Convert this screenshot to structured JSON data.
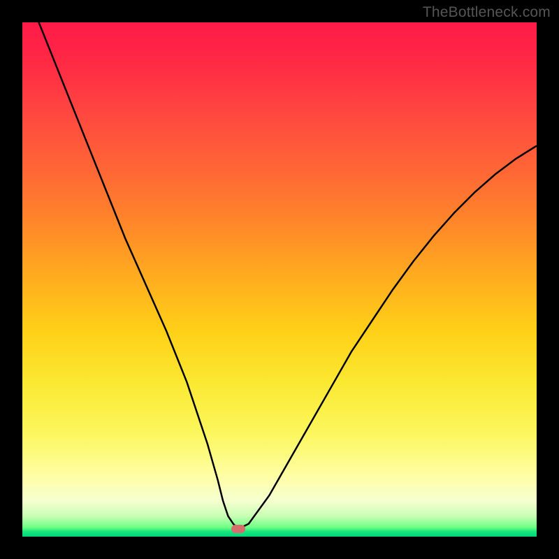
{
  "watermark": "TheBottleneck.com",
  "colors": {
    "frame": "#000000",
    "marker": "#d86d6d",
    "curve": "#000000",
    "gradient_top": "#ff1a48",
    "gradient_bottom": "#00d47a"
  },
  "chart_data": {
    "type": "line",
    "title": "",
    "xlabel": "",
    "ylabel": "",
    "xlim": [
      0,
      100
    ],
    "ylim": [
      0,
      100
    ],
    "grid": false,
    "legend": false,
    "marker": {
      "x": 42,
      "y": 1.5
    },
    "series": [
      {
        "name": "bottleneck-curve",
        "x": [
          0,
          4,
          8,
          12,
          16,
          20,
          24,
          28,
          32,
          36,
          38,
          39,
          40,
          41,
          42,
          44,
          48,
          52,
          56,
          60,
          64,
          68,
          72,
          76,
          80,
          84,
          88,
          92,
          96,
          100
        ],
        "values": [
          108,
          98,
          88,
          78,
          68,
          58,
          49,
          40,
          30,
          18,
          11,
          7,
          4,
          2.5,
          1.5,
          2.5,
          8,
          15,
          22,
          29,
          36,
          42,
          48,
          53.5,
          58.5,
          63,
          67,
          70.5,
          73.5,
          76
        ]
      }
    ],
    "annotations": []
  }
}
